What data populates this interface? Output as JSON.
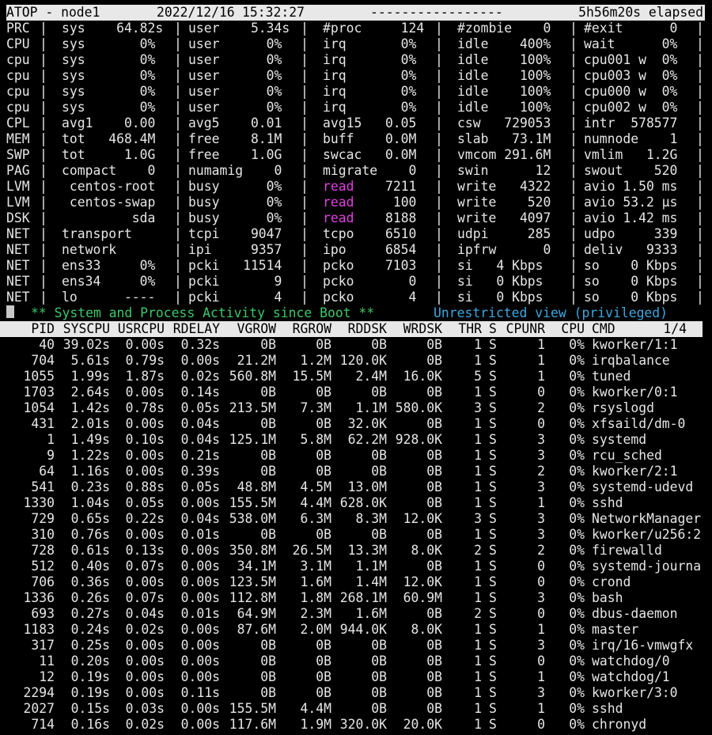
{
  "header": {
    "program": "ATOP - node1",
    "date": "2022/12/16",
    "time": "15:32:27",
    "dashes": "-----------------",
    "elapsed": "5h56m20s elapsed"
  },
  "system_lines": [
    [
      "PRC",
      "|",
      "sys    64.82s",
      "|",
      "user    5.34s",
      "|",
      "#proc     124",
      "|",
      "#zombie    0",
      "|",
      "#exit      0",
      "|"
    ],
    [
      "CPU",
      "|",
      "sys       0%",
      "|",
      "user      0%",
      "|",
      "irq       0%",
      "|",
      "idle    400%",
      "|",
      "wait      0%",
      "|"
    ],
    [
      "cpu",
      "|",
      "sys       0%",
      "|",
      "user      0%",
      "|",
      "irq       0%",
      "|",
      "idle    100%",
      "|",
      "cpu001 w  0%",
      "|"
    ],
    [
      "cpu",
      "|",
      "sys       0%",
      "|",
      "user      0%",
      "|",
      "irq       0%",
      "|",
      "idle    100%",
      "|",
      "cpu003 w  0%",
      "|"
    ],
    [
      "cpu",
      "|",
      "sys       0%",
      "|",
      "user      0%",
      "|",
      "irq       0%",
      "|",
      "idle    100%",
      "|",
      "cpu000 w  0%",
      "|"
    ],
    [
      "cpu",
      "|",
      "sys       0%",
      "|",
      "user      0%",
      "|",
      "irq       0%",
      "|",
      "idle    100%",
      "|",
      "cpu002 w  0%",
      "|"
    ],
    [
      "CPL",
      "|",
      "avg1    0.00",
      "|",
      "avg5    0.01",
      "|",
      "avg15   0.05",
      "|",
      "csw   729053",
      "|",
      "intr  578577",
      "|"
    ],
    [
      "MEM",
      "|",
      "tot   468.4M",
      "|",
      "free    8.1M",
      "|",
      "buff    0.0M",
      "|",
      "slab   73.1M",
      "|",
      "numnode    1",
      "|"
    ],
    [
      "SWP",
      "|",
      "tot     1.0G",
      "|",
      "free    1.0G",
      "|",
      "swcac   0.0M",
      "|",
      "vmcom 291.6M",
      "|",
      "vmlim   1.2G",
      "|"
    ],
    [
      "PAG",
      "|",
      "compact    0",
      "|",
      "numamig    0",
      "|",
      "migrate    0",
      "|",
      "swin      12",
      "|",
      "swout    520",
      "|"
    ],
    [
      "LVM",
      "|",
      " centos-root",
      "|",
      "busy      0%",
      "|",
      "read    7211",
      "|",
      "write   4322",
      "|",
      "avio 1.50 ms",
      "|"
    ],
    [
      "LVM",
      "|",
      " centos-swap",
      "|",
      "busy      0%",
      "|",
      "read     100",
      "|",
      "write    520",
      "|",
      "avio 53.2 µs",
      "|"
    ],
    [
      "DSK",
      "|",
      "         sda",
      "|",
      "busy      0%",
      "|",
      "read    8188",
      "|",
      "write   4097",
      "|",
      "avio 1.42 ms",
      "|"
    ],
    [
      "NET",
      "|",
      "transport   ",
      "|",
      "tcpi    9047",
      "|",
      "tcpo    6510",
      "|",
      "udpi     285",
      "|",
      "udpo     339",
      "|"
    ],
    [
      "NET",
      "|",
      "network     ",
      "|",
      "ipi     9357",
      "|",
      "ipo     6854",
      "|",
      "ipfrw      0",
      "|",
      "deliv   9333",
      "|"
    ],
    [
      "NET",
      "|",
      "ens33     0%",
      "|",
      "pcki   11514",
      "|",
      "pcko    7103",
      "|",
      "si   4 Kbps ",
      "|",
      "so    0 Kbps",
      "|"
    ],
    [
      "NET",
      "|",
      "ens34     0%",
      "|",
      "pcki       9",
      "|",
      "pcko       0",
      "|",
      "si   0 Kbps ",
      "|",
      "so    0 Kbps",
      "|"
    ],
    [
      "NET",
      "|",
      "lo      ----",
      "|",
      "pcki       4",
      "|",
      "pcko       4",
      "|",
      "si   0 Kbps ",
      "|",
      "so    0 Kbps",
      "|"
    ]
  ],
  "status": {
    "activity": "** System and Process Activity since Boot **",
    "view": "Unrestricted view (privileged)"
  },
  "process_header": {
    "columns": [
      "PID",
      "SYSCPU",
      "USRCPU",
      "RDELAY",
      "VGROW",
      "RGROW",
      "RDDSK",
      "WRDSK",
      "THR",
      "S",
      "CPUNR",
      "CPU",
      "CMD"
    ],
    "page": "1/4"
  },
  "processes": [
    [
      "40",
      "39.02s",
      "0.00s",
      "0.32s",
      "0B",
      "0B",
      "0B",
      "0B",
      "1",
      "S",
      "1",
      "0%",
      "kworker/1:1"
    ],
    [
      "704",
      "5.61s",
      "0.79s",
      "0.00s",
      "21.2M",
      "1.2M",
      "120.0K",
      "0B",
      "1",
      "S",
      "1",
      "0%",
      "irqbalance"
    ],
    [
      "1055",
      "1.99s",
      "1.87s",
      "0.02s",
      "560.8M",
      "15.5M",
      "2.4M",
      "16.0K",
      "5",
      "S",
      "1",
      "0%",
      "tuned"
    ],
    [
      "1703",
      "2.64s",
      "0.00s",
      "0.14s",
      "0B",
      "0B",
      "0B",
      "0B",
      "1",
      "S",
      "0",
      "0%",
      "kworker/0:1"
    ],
    [
      "1054",
      "1.42s",
      "0.78s",
      "0.05s",
      "213.5M",
      "7.3M",
      "1.1M",
      "580.0K",
      "3",
      "S",
      "2",
      "0%",
      "rsyslogd"
    ],
    [
      "431",
      "2.01s",
      "0.00s",
      "0.04s",
      "0B",
      "0B",
      "32.0K",
      "0B",
      "1",
      "S",
      "0",
      "0%",
      "xfsaild/dm-0"
    ],
    [
      "1",
      "1.49s",
      "0.10s",
      "0.04s",
      "125.1M",
      "5.8M",
      "62.2M",
      "928.0K",
      "1",
      "S",
      "3",
      "0%",
      "systemd"
    ],
    [
      "9",
      "1.22s",
      "0.00s",
      "0.21s",
      "0B",
      "0B",
      "0B",
      "0B",
      "1",
      "S",
      "3",
      "0%",
      "rcu_sched"
    ],
    [
      "64",
      "1.16s",
      "0.00s",
      "0.39s",
      "0B",
      "0B",
      "0B",
      "0B",
      "1",
      "S",
      "2",
      "0%",
      "kworker/2:1"
    ],
    [
      "541",
      "0.23s",
      "0.88s",
      "0.05s",
      "48.8M",
      "4.5M",
      "13.0M",
      "0B",
      "1",
      "S",
      "3",
      "0%",
      "systemd-udevd"
    ],
    [
      "1330",
      "1.04s",
      "0.05s",
      "0.00s",
      "155.5M",
      "4.4M",
      "628.0K",
      "0B",
      "1",
      "S",
      "1",
      "0%",
      "sshd"
    ],
    [
      "729",
      "0.65s",
      "0.22s",
      "0.04s",
      "538.0M",
      "6.3M",
      "8.3M",
      "12.0K",
      "3",
      "S",
      "3",
      "0%",
      "NetworkManager"
    ],
    [
      "310",
      "0.76s",
      "0.00s",
      "0.01s",
      "0B",
      "0B",
      "0B",
      "0B",
      "1",
      "S",
      "3",
      "0%",
      "kworker/u256:2"
    ],
    [
      "728",
      "0.61s",
      "0.13s",
      "0.00s",
      "350.8M",
      "26.5M",
      "13.3M",
      "8.0K",
      "2",
      "S",
      "2",
      "0%",
      "firewalld"
    ],
    [
      "512",
      "0.40s",
      "0.07s",
      "0.00s",
      "34.1M",
      "3.1M",
      "1.1M",
      "0B",
      "1",
      "S",
      "0",
      "0%",
      "systemd-journa"
    ],
    [
      "706",
      "0.36s",
      "0.00s",
      "0.00s",
      "123.5M",
      "1.6M",
      "1.4M",
      "12.0K",
      "1",
      "S",
      "0",
      "0%",
      "crond"
    ],
    [
      "1336",
      "0.26s",
      "0.07s",
      "0.00s",
      "112.8M",
      "1.8M",
      "268.1M",
      "60.9M",
      "1",
      "S",
      "3",
      "0%",
      "bash"
    ],
    [
      "693",
      "0.27s",
      "0.04s",
      "0.01s",
      "64.9M",
      "2.3M",
      "1.6M",
      "0B",
      "2",
      "S",
      "0",
      "0%",
      "dbus-daemon"
    ],
    [
      "1183",
      "0.24s",
      "0.02s",
      "0.00s",
      "87.6M",
      "2.0M",
      "944.0K",
      "8.0K",
      "1",
      "S",
      "1",
      "0%",
      "master"
    ],
    [
      "317",
      "0.25s",
      "0.00s",
      "0.00s",
      "0B",
      "0B",
      "0B",
      "0B",
      "1",
      "S",
      "3",
      "0%",
      "irq/16-vmwgfx"
    ],
    [
      "11",
      "0.20s",
      "0.00s",
      "0.00s",
      "0B",
      "0B",
      "0B",
      "0B",
      "1",
      "S",
      "0",
      "0%",
      "watchdog/0"
    ],
    [
      "12",
      "0.19s",
      "0.00s",
      "0.00s",
      "0B",
      "0B",
      "0B",
      "0B",
      "1",
      "S",
      "1",
      "0%",
      "watchdog/1"
    ],
    [
      "2294",
      "0.19s",
      "0.00s",
      "0.11s",
      "0B",
      "0B",
      "0B",
      "0B",
      "1",
      "S",
      "3",
      "0%",
      "kworker/3:0"
    ],
    [
      "2027",
      "0.15s",
      "0.03s",
      "0.00s",
      "155.5M",
      "4.4M",
      "0B",
      "0B",
      "1",
      "S",
      "1",
      "0%",
      "sshd"
    ],
    [
      "714",
      "0.16s",
      "0.02s",
      "0.00s",
      "117.6M",
      "1.9M",
      "320.0K",
      "20.0K",
      "1",
      "S",
      "0",
      "0%",
      "chronyd"
    ]
  ],
  "colors": {
    "background": "#000000",
    "text": "#e6e6e6",
    "bar_background": "#e8e8e8",
    "status_green": "#3cc868",
    "status_cyan": "#3ca8e0",
    "disk_read_magenta": "#e040e0"
  }
}
